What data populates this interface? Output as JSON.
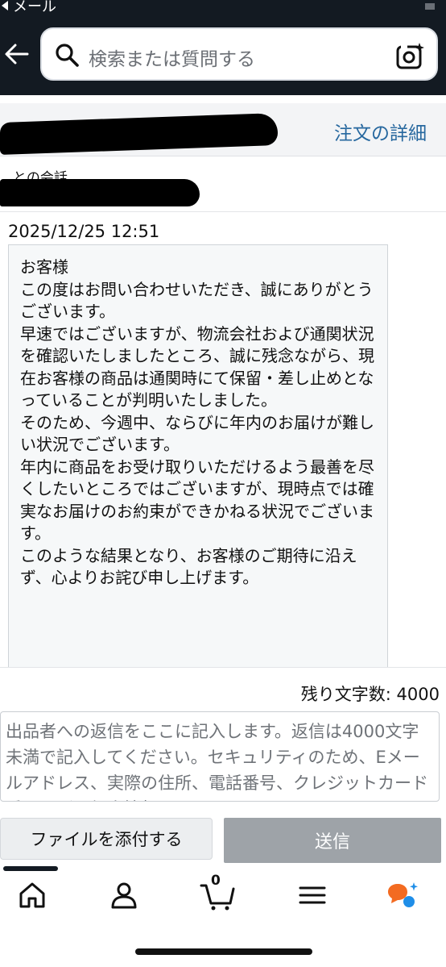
{
  "status_bar": {
    "back_app_label": "メール"
  },
  "search": {
    "placeholder": "検索または質問する"
  },
  "order_header": {
    "order_detail_link": "注文の詳細"
  },
  "conversation": {
    "with_label": "との会話",
    "timestamp": "2025/12/25 12:51",
    "message": "お客様\nこの度はお問い合わせいただき、誠にありがとうございます。\n早速ではございますが、物流会社および通関状況を確認いたしましたところ、誠に残念ながら、現在お客様の商品は通関時にて保留・差し止めとなっていることが判明いたしました。\nそのため、今週中、ならびに年内のお届けが難しい状況でございます。\n年内に商品をお受け取りいただけるよう最善を尽くしたいところではございますが、現時点では確実なお届けのお約束ができかねる状況でございます。\nこのような結果となり、お客様のご期待に沿えず、心よりお詫び申し上げます。"
  },
  "reply": {
    "remaining_label": "残り文字数: 4000",
    "placeholder": "出品者への返信をここに記入します。返信は4000文字未満で記入してください。セキュリティのため、Eメールアドレス、実際の住所、電話番号、クレジットカード番号などの個人情報を"
  },
  "buttons": {
    "attach_label": "ファイルを添付する",
    "send_label": "送信"
  },
  "bottom_nav": {
    "items": [
      "home-icon",
      "account-icon",
      "cart-icon",
      "menu-icon",
      "rufus-assistant-icon"
    ],
    "cart_count": "0"
  },
  "colors": {
    "header_bg": "#131a22",
    "link": "#27689f",
    "send_disabled": "#9ea3a8",
    "assistant_orange": "#f36b21",
    "assistant_blue": "#1f8ee8"
  }
}
